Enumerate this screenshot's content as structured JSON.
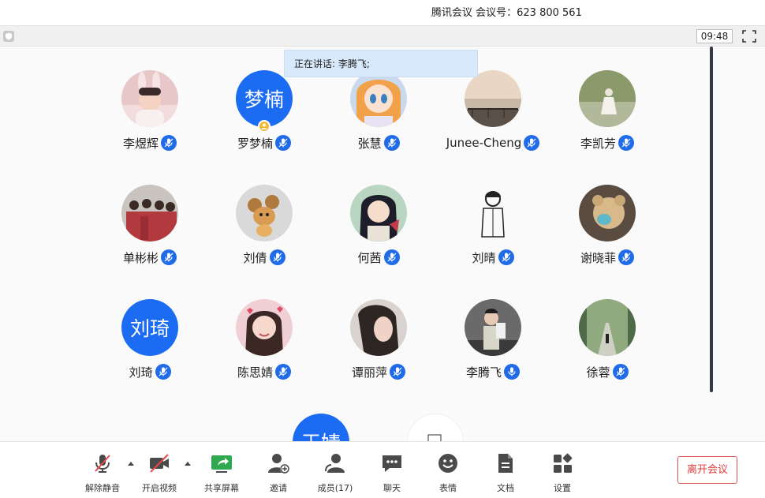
{
  "window": {
    "title": "腾讯会议 会议号：623 800 561"
  },
  "status_bar": {
    "time": "09:48"
  },
  "speaking_banner": {
    "text": "正在讲话: 李腾飞;"
  },
  "participants": [
    {
      "name": "李煜辉",
      "avatar": "photo-girl-bunny-ears"
    },
    {
      "name": "罗梦楠",
      "avatar_text": "梦楠",
      "host": true
    },
    {
      "name": "张慧",
      "avatar": "photo-anime-girl"
    },
    {
      "name": "Junee-Cheng",
      "avatar": "photo-lake-sunset"
    },
    {
      "name": "李凯芳",
      "avatar": "photo-park-dancer"
    },
    {
      "name": "单彬彬",
      "avatar": "photo-group-red"
    },
    {
      "name": "刘倩",
      "avatar": "photo-cartoon-mouse"
    },
    {
      "name": "何茜",
      "avatar": "photo-anime-girl-dark-hair"
    },
    {
      "name": "刘晴",
      "avatar": "photo-sketch-figure"
    },
    {
      "name": "谢晓菲",
      "avatar": "photo-plush-bear"
    },
    {
      "name": "刘琦",
      "avatar_text": "刘琦"
    },
    {
      "name": "陈思婧",
      "avatar": "photo-girl-hearts"
    },
    {
      "name": "谭丽萍",
      "avatar": "photo-woman-long-hair"
    },
    {
      "name": "李腾飞",
      "avatar": "photo-man-glasses",
      "speaking": true
    },
    {
      "name": "徐蓉",
      "avatar": "photo-tree-road"
    }
  ],
  "partial_row": [
    {
      "avatar_text": "王婧"
    },
    {
      "avatar": "photo-white"
    }
  ],
  "toolbar": {
    "unmute": "解除静音",
    "start_video": "开启视频",
    "share_screen": "共享屏幕",
    "invite": "邀请",
    "members": "成员(17)",
    "chat": "聊天",
    "reactions": "表情",
    "documents": "文档",
    "settings": "设置",
    "leave": "离开会议"
  },
  "colors": {
    "accent": "#1f6be8",
    "leave": "#e03c3c",
    "speaking_bg": "#d8e9fc",
    "host_badge": "#f5b631",
    "share_green": "#2fa84f",
    "muted_red": "#e5484d"
  },
  "icons": {
    "mic": "mic-icon",
    "mic_muted": "mic-muted-icon",
    "video_off": "video-off-icon",
    "share": "share-screen-icon",
    "invite": "add-user-icon",
    "members": "members-icon",
    "chat": "chat-icon",
    "reactions": "smile-icon",
    "documents": "document-icon",
    "settings": "settings-icon"
  }
}
